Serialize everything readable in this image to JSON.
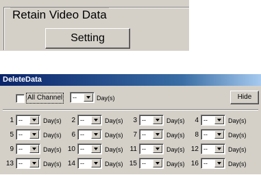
{
  "retain": {
    "group_title": "Retain Video Data",
    "setting_label": "Setting"
  },
  "delete": {
    "title": "DeleteData",
    "all_channel_label": "All Channel",
    "all_channel_checked": false,
    "all_value": "--",
    "days_label": "Day(s)",
    "hide_label": "Hide",
    "channels": [
      {
        "num": "1",
        "value": "--"
      },
      {
        "num": "2",
        "value": "--"
      },
      {
        "num": "3",
        "value": "--"
      },
      {
        "num": "4",
        "value": "--"
      },
      {
        "num": "5",
        "value": "--"
      },
      {
        "num": "6",
        "value": "--"
      },
      {
        "num": "7",
        "value": "--"
      },
      {
        "num": "8",
        "value": "--"
      },
      {
        "num": "9",
        "value": "--"
      },
      {
        "num": "10",
        "value": "--"
      },
      {
        "num": "11",
        "value": "--"
      },
      {
        "num": "12",
        "value": "--"
      },
      {
        "num": "13",
        "value": "--"
      },
      {
        "num": "14",
        "value": "--"
      },
      {
        "num": "15",
        "value": "--"
      },
      {
        "num": "16",
        "value": "--"
      }
    ]
  },
  "icons": {
    "dropdown": "chevron-down-icon",
    "checkbox": "checkbox-icon"
  },
  "colors": {
    "title_bar_start": "#0a246a",
    "title_bar_end": "#a6caf0",
    "panel": "#d4d0c8"
  }
}
